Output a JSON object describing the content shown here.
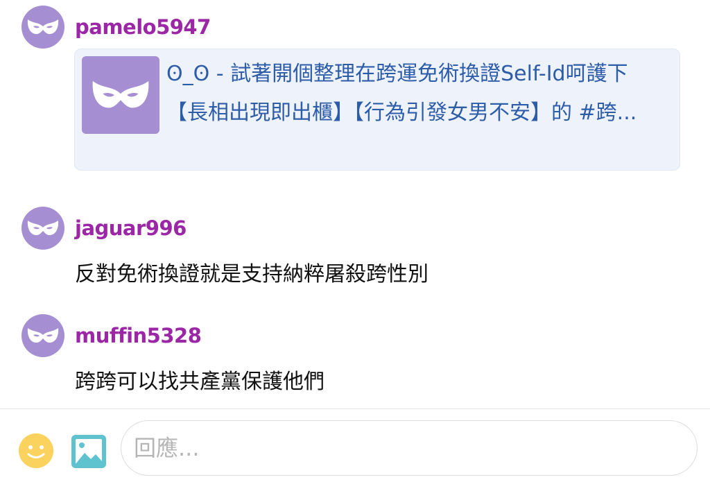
{
  "comments": [
    {
      "username": "pamelo5947",
      "avatar_icon": "mask-icon",
      "link_card": {
        "thumbnail_icon": "mask-icon",
        "text": "ʘ_ʘ - 試著開個整理在跨運免術換證Self-Id呵護下【長相出現即出櫃】【行為引發女男不安】的 #跨..."
      }
    },
    {
      "username": "jaguar996",
      "avatar_icon": "mask-icon",
      "text": "反對免術換證就是支持納粹屠殺跨性別"
    },
    {
      "username": "muffin5328",
      "avatar_icon": "mask-icon",
      "text": "跨跨可以找共產黨保護他們"
    }
  ],
  "composer": {
    "emoji_icon": "smiley-icon",
    "image_icon": "image-icon",
    "placeholder": "回應..."
  },
  "colors": {
    "avatar": "#a58fd2",
    "username": "#9c27a6",
    "link_text": "#2d5ca8",
    "card_bg": "#eef2fb",
    "emoji": "#fcd25e",
    "image_icon": "#5fc3cf"
  }
}
